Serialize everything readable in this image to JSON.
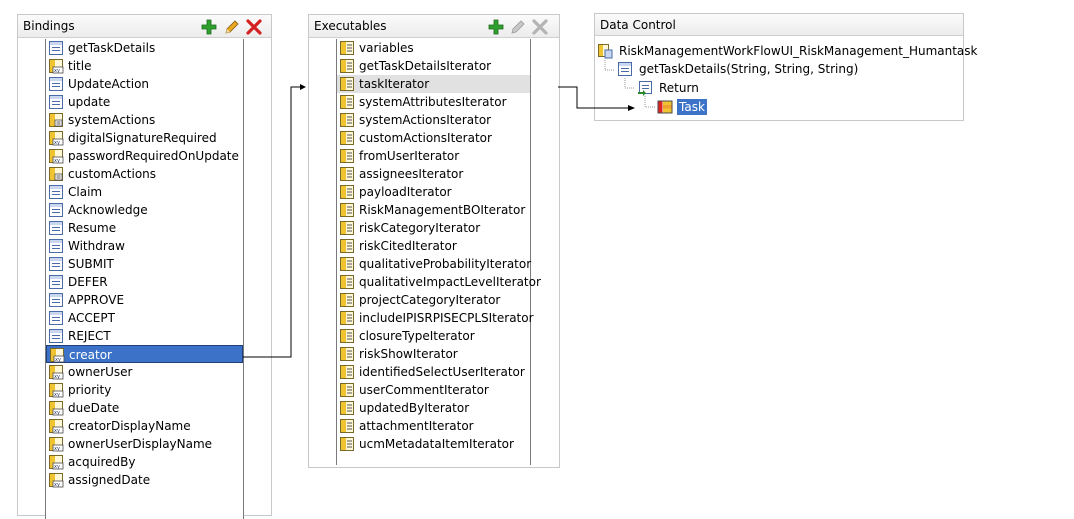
{
  "bindings": {
    "title": "Bindings",
    "toolbar": [
      "add-icon",
      "edit-icon",
      "delete-icon"
    ],
    "items": [
      {
        "label": "getTaskDetails",
        "icon": "method-icon"
      },
      {
        "label": "title",
        "icon": "attribute-value-icon"
      },
      {
        "label": "UpdateAction",
        "icon": "method-icon"
      },
      {
        "label": "update",
        "icon": "method-icon"
      },
      {
        "label": "systemActions",
        "icon": "tree-binding-icon"
      },
      {
        "label": "digitalSignatureRequired",
        "icon": "attribute-value-icon"
      },
      {
        "label": "passwordRequiredOnUpdate",
        "icon": "attribute-value-icon"
      },
      {
        "label": "customActions",
        "icon": "tree-binding-icon"
      },
      {
        "label": "Claim",
        "icon": "method-icon"
      },
      {
        "label": "Acknowledge",
        "icon": "method-icon"
      },
      {
        "label": "Resume",
        "icon": "method-icon"
      },
      {
        "label": "Withdraw",
        "icon": "method-icon"
      },
      {
        "label": "SUBMIT",
        "icon": "method-icon"
      },
      {
        "label": "DEFER",
        "icon": "method-icon"
      },
      {
        "label": "APPROVE",
        "icon": "method-icon"
      },
      {
        "label": "ACCEPT",
        "icon": "method-icon"
      },
      {
        "label": "REJECT",
        "icon": "method-icon"
      },
      {
        "label": "creator",
        "icon": "attribute-value-icon"
      },
      {
        "label": "ownerUser",
        "icon": "attribute-value-icon"
      },
      {
        "label": "priority",
        "icon": "attribute-value-icon"
      },
      {
        "label": "dueDate",
        "icon": "attribute-value-icon"
      },
      {
        "label": "creatorDisplayName",
        "icon": "attribute-value-icon"
      },
      {
        "label": "ownerUserDisplayName",
        "icon": "attribute-value-icon"
      },
      {
        "label": "acquiredBy",
        "icon": "attribute-value-icon"
      },
      {
        "label": "assignedDate",
        "icon": "attribute-value-icon"
      }
    ],
    "selected_index": 17
  },
  "executables": {
    "title": "Executables",
    "toolbar": [
      "add-icon",
      "edit-icon-disabled",
      "delete-icon-disabled"
    ],
    "items": [
      {
        "label": "variables",
        "icon": "iterator-icon"
      },
      {
        "label": "getTaskDetailsIterator",
        "icon": "iterator-icon"
      },
      {
        "label": "taskIterator",
        "icon": "iterator-icon"
      },
      {
        "label": "systemAttributesIterator",
        "icon": "iterator-icon"
      },
      {
        "label": "systemActionsIterator",
        "icon": "iterator-icon"
      },
      {
        "label": "customActionsIterator",
        "icon": "iterator-icon"
      },
      {
        "label": "fromUserIterator",
        "icon": "iterator-icon"
      },
      {
        "label": "assigneesIterator",
        "icon": "iterator-icon"
      },
      {
        "label": "payloadIterator",
        "icon": "iterator-icon"
      },
      {
        "label": "RiskManagementBOIterator",
        "icon": "iterator-icon"
      },
      {
        "label": "riskCategoryIterator",
        "icon": "iterator-icon"
      },
      {
        "label": "riskCitedIterator",
        "icon": "iterator-icon"
      },
      {
        "label": "qualitativeProbabilityIterator",
        "icon": "iterator-icon"
      },
      {
        "label": "qualitativeImpactLevelIterator",
        "icon": "iterator-icon"
      },
      {
        "label": "projectCategoryIterator",
        "icon": "iterator-icon"
      },
      {
        "label": "includeIPISRPISECPLSIterator",
        "icon": "iterator-icon"
      },
      {
        "label": "closureTypeIterator",
        "icon": "iterator-icon"
      },
      {
        "label": "riskShowIterator",
        "icon": "iterator-icon"
      },
      {
        "label": "identifiedSelectUserIterator",
        "icon": "iterator-icon"
      },
      {
        "label": "userCommentIterator",
        "icon": "iterator-icon"
      },
      {
        "label": "updatedByIterator",
        "icon": "iterator-icon"
      },
      {
        "label": "attachmentIterator",
        "icon": "iterator-icon"
      },
      {
        "label": "ucmMetadataItemIterator",
        "icon": "iterator-icon"
      }
    ],
    "highlighted_index": 2
  },
  "data_control": {
    "title": "Data Control",
    "root": {
      "label": "RiskManagementWorkFlowUI_RiskManagement_Humantask",
      "icon": "data-control-icon"
    },
    "method": {
      "label": "getTaskDetails(String, String, String)",
      "icon": "method-icon"
    },
    "return": {
      "label": "Return",
      "icon": "return-icon"
    },
    "task": {
      "label": "Task",
      "icon": "collection-icon"
    }
  },
  "colors": {
    "selection": "#3c73c8",
    "highlight": "#e1e1e1",
    "add": "#2ea02e",
    "edit": "#d89a1a",
    "delete": "#d42020"
  }
}
